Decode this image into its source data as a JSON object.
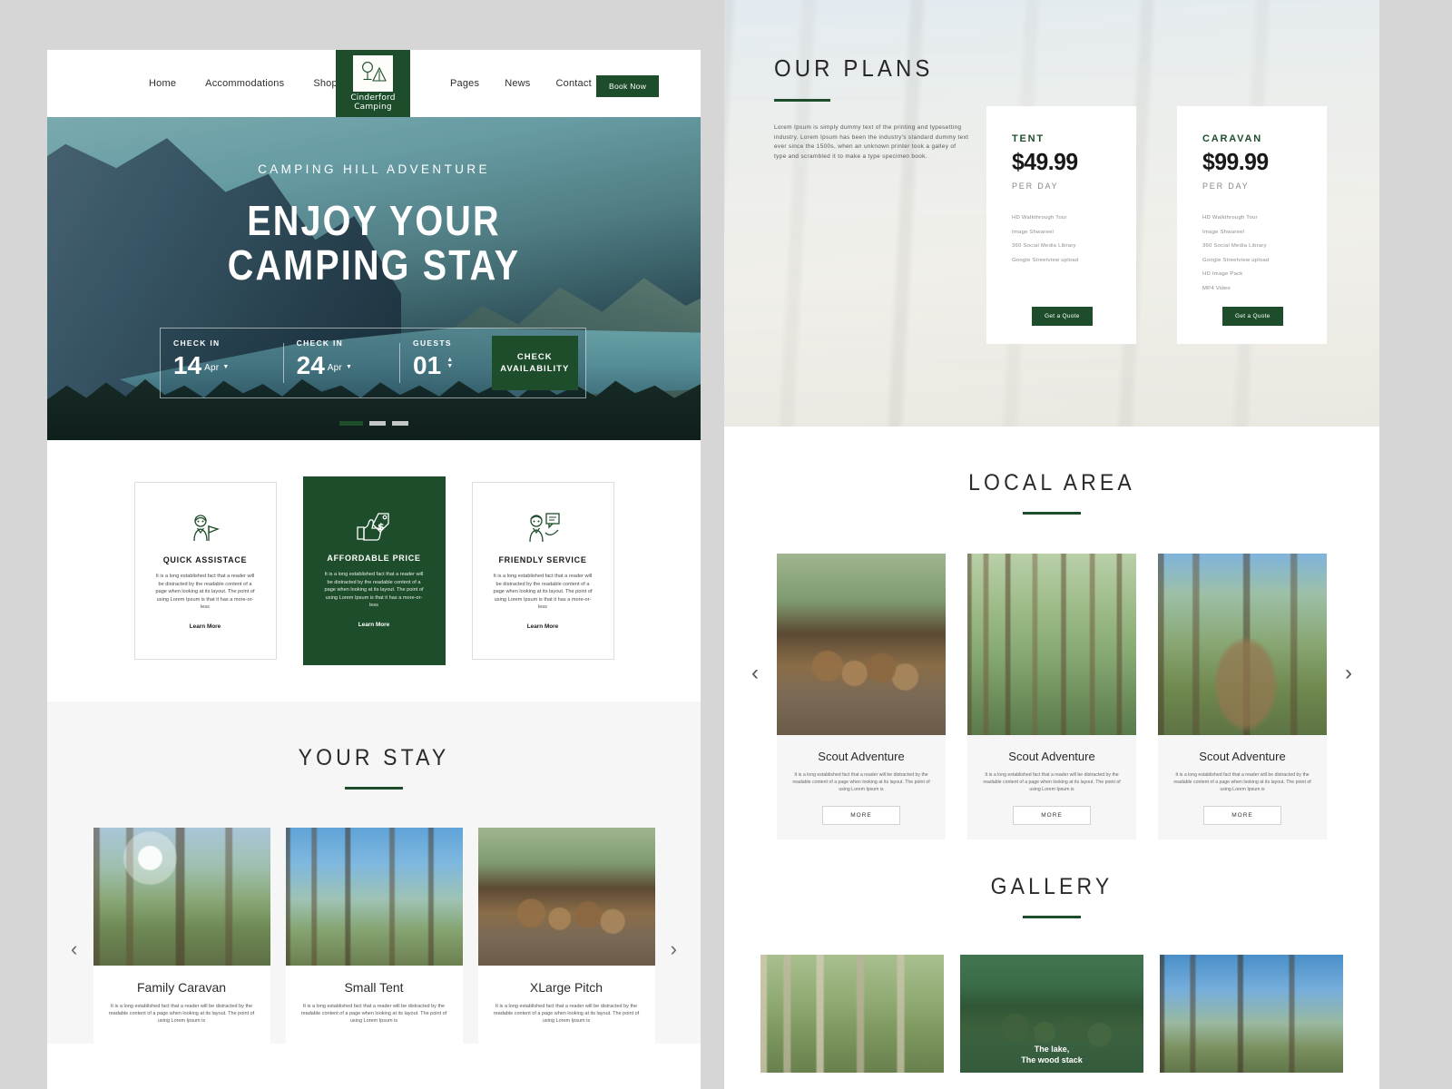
{
  "brand": {
    "logo_line1": "Cinderford",
    "logo_line2": "Camping",
    "logo_icon": "tree-tent-icon",
    "accent_green": "#1e4d2b"
  },
  "header": {
    "nav_left": [
      {
        "label": "Home"
      },
      {
        "label": "Accommodations"
      },
      {
        "label": "Shop"
      }
    ],
    "nav_right": [
      {
        "label": "Pages"
      },
      {
        "label": "News"
      },
      {
        "label": "Contact"
      }
    ],
    "cta_label": "Book Now"
  },
  "hero": {
    "kicker": "CAMPING HILL ADVENTURE",
    "title_line1": "ENJOY YOUR",
    "title_line2": "CAMPING STAY",
    "booking": {
      "checkin_label": "CHECK IN",
      "checkin_value": "14",
      "checkin_month": "Apr",
      "checkout_label": "CHECK IN",
      "checkout_value": "24",
      "checkout_month": "Apr",
      "guests_label": "GUESTS",
      "guests_value": "01",
      "cta_line1": "CHECK",
      "cta_line2": "AVAILABILITY"
    },
    "slides": 3,
    "active_slide": 1
  },
  "features": [
    {
      "icon": "scout-person-flag-icon",
      "title": "QUICK ASSISTACE",
      "desc": "It is a long established fact that a reader will be distracted by the readable content of a page when looking at its layout. The point of using Lorem Ipsum is that it has a more-or-less",
      "link": "Learn More",
      "featured": false
    },
    {
      "icon": "thumbs-up-price-tag-icon",
      "title": "AFFORDABLE PRICE",
      "desc": "It is a long established fact that a reader will be distracted by the readable content of a page when looking at its layout. The point of using Lorem Ipsum is that it has a more-or-less",
      "link": "Learn More",
      "featured": true
    },
    {
      "icon": "person-speech-bubble-icon",
      "title": "FRIENDLY SERVICE",
      "desc": "It is a long established fact that a reader will be distracted by the readable content of a page when looking at its layout. The point of using Lorem Ipsum is that it has a more-or-less",
      "link": "Learn More",
      "featured": false
    }
  ],
  "your_stay": {
    "title": "YOUR STAY",
    "prev_icon": "chevron-left-icon",
    "next_icon": "chevron-right-icon",
    "cards": [
      {
        "name": "Family Caravan",
        "desc": "It is a long established fact that a reader will be distracted by the readable content of a page when looking at its layout. The point of using Lorem Ipsum is",
        "photo": "sunlit-woodland-clearing"
      },
      {
        "name": "Small Tent",
        "desc": "It is a long established fact that a reader will be distracted by the readable content of a page when looking at its layout. The point of using Lorem Ipsum is",
        "photo": "tall-trees-blue-sky-benches"
      },
      {
        "name": "XLarge Pitch",
        "desc": "It is a long established fact that a reader will be distracted by the readable content of a page when looking at its layout. The point of using Lorem Ipsum is",
        "photo": "log-store-wood-stack"
      }
    ]
  },
  "plans": {
    "title": "OUR PLANS",
    "desc": "Lorem Ipsum is simply dummy text of the printing and typesetting industry. Lorem Ipsum has been the industry's standard dummy text ever since the 1500s, when an unknown printer took a galley of type and scrambled it to make a type specimen book.",
    "cards": [
      {
        "name": "TENT",
        "price": "$49.99",
        "period": "PER DAY",
        "features": [
          "HD Walkthrough Tour",
          "Image Shwareel",
          "360 Social Media Library",
          "Google Streetview upload"
        ],
        "cta": "Get a Quote"
      },
      {
        "name": "CARAVAN",
        "price": "$99.99",
        "period": "PER DAY",
        "features": [
          "HD Walkthrough Tour",
          "Image Shwareel",
          "360 Social Media Library",
          "Google Streetview upload",
          "HD Image Pack",
          "MP4 Video"
        ],
        "cta": "Get a Quote"
      }
    ]
  },
  "local_area": {
    "title": "LOCAL AREA",
    "prev_icon": "chevron-left-icon",
    "next_icon": "chevron-right-icon",
    "cards": [
      {
        "name": "Scout Adventure",
        "desc": "It is a long established fact that a reader will be distracted by the readable content of a page when looking at its layout. The point of using Lorem Ipsum is",
        "more_label": "MORE",
        "photo": "log-store-wood-stack"
      },
      {
        "name": "Scout Adventure",
        "desc": "It is a long established fact that a reader will be distracted by the readable content of a page when looking at its layout. The point of using Lorem Ipsum is",
        "more_label": "MORE",
        "photo": "spring-woodland-floor"
      },
      {
        "name": "Scout Adventure",
        "desc": "It is a long established fact that a reader will be distracted by the readable content of a page when looking at its layout. The point of using Lorem Ipsum is",
        "more_label": "MORE",
        "photo": "fallen-log-woodland"
      }
    ]
  },
  "gallery": {
    "title": "GALLERY",
    "items": [
      {
        "photo": "birch-woodland",
        "caption": "",
        "overlay": false
      },
      {
        "photo": "wood-store-green",
        "caption": "The lake,\nThe wood stack",
        "overlay": true
      },
      {
        "photo": "lakeside-bare-trees",
        "caption": "",
        "overlay": false
      }
    ]
  }
}
